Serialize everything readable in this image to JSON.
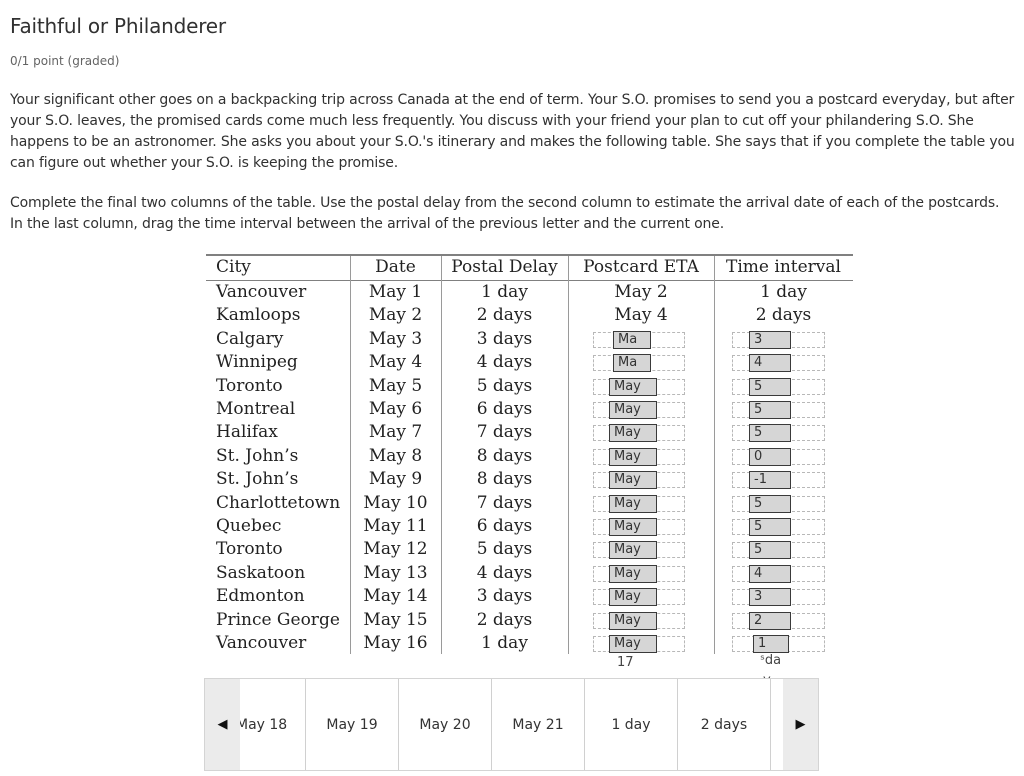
{
  "problem": {
    "title": "Faithful or Philanderer",
    "points": "0/1 point (graded)",
    "paragraph1": "Your significant other goes on a backpacking trip across Canada at the end of term. Your S.O. promises to send you a postcard everyday, but after your S.O. leaves, the promised cards come much less frequently. You discuss with your friend your plan to cut off your philandering S.O. She happens to be an astronomer. She asks you about your S.O.'s itinerary and makes the following table. She says that if you complete the table you can figure out whether your S.O. is keeping the promise.",
    "paragraph2": "Complete the final two columns of the table. Use the postal delay from the second column to estimate the arrival date of each of the postcards. In the last column, drag the time interval between the arrival of the previous letter and the current one."
  },
  "table": {
    "headers": [
      "City",
      "Date",
      "Postal Delay",
      "Postcard ETA",
      "Time interval"
    ],
    "rows": [
      {
        "city": "Vancouver",
        "date": "May 1",
        "delay": "1 day",
        "eta": "May 2",
        "interval": "1 day"
      },
      {
        "city": "Kamloops",
        "date": "May 2",
        "delay": "2 days",
        "eta": "May 4",
        "interval": "2 days"
      },
      {
        "city": "Calgary",
        "date": "May 3",
        "delay": "3 days",
        "eta_chip": "Ma",
        "interval_chip": "3"
      },
      {
        "city": "Winnipeg",
        "date": "May 4",
        "delay": "4 days",
        "eta_chip": "Ma",
        "interval_chip": "4"
      },
      {
        "city": "Toronto",
        "date": "May 5",
        "delay": "5 days",
        "eta_chip": "May",
        "interval_chip": "5"
      },
      {
        "city": "Montreal",
        "date": "May 6",
        "delay": "6 days",
        "eta_chip": "May",
        "interval_chip": "5"
      },
      {
        "city": "Halifax",
        "date": "May 7",
        "delay": "7 days",
        "eta_chip": "May",
        "interval_chip": "5"
      },
      {
        "city": "St. John’s",
        "date": "May 8",
        "delay": "8 days",
        "eta_chip": "May",
        "interval_chip": "0"
      },
      {
        "city": "St. John’s",
        "date": "May 9",
        "delay": "8 days",
        "eta_chip": "May",
        "interval_chip": "-1"
      },
      {
        "city": "Charlottetown",
        "date": "May 10",
        "delay": "7 days",
        "eta_chip": "May",
        "interval_chip": "5"
      },
      {
        "city": "Quebec",
        "date": "May 11",
        "delay": "6 days",
        "eta_chip": "May",
        "interval_chip": "5"
      },
      {
        "city": "Toronto",
        "date": "May 12",
        "delay": "5 days",
        "eta_chip": "May",
        "interval_chip": "5"
      },
      {
        "city": "Saskatoon",
        "date": "May 13",
        "delay": "4 days",
        "eta_chip": "May",
        "interval_chip": "4"
      },
      {
        "city": "Edmonton",
        "date": "May 14",
        "delay": "3 days",
        "eta_chip": "May",
        "interval_chip": "3"
      },
      {
        "city": "Prince George",
        "date": "May 15",
        "delay": "2 days",
        "eta_chip": "May",
        "interval_chip": "2"
      },
      {
        "city": "Vancouver",
        "date": "May 16",
        "delay": "1 day",
        "eta_chip": "May",
        "interval_chip": "1"
      }
    ],
    "eta_overflow": "17",
    "interval_overflow_line1": "ˢda",
    "interval_overflow_line2": "y"
  },
  "tray": {
    "prev_icon": "◀",
    "next_icon": "▶",
    "items": [
      "May 18",
      "May 19",
      "May 20",
      "May 21",
      "1 day",
      "2 days"
    ]
  }
}
